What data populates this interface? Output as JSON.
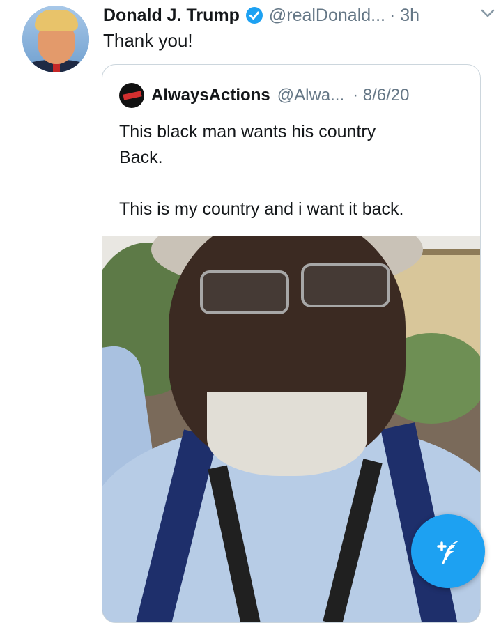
{
  "tweet": {
    "author_name": "Donald J. Trump",
    "author_handle": "@realDonald...",
    "time": "· 3h",
    "text": "Thank you!",
    "verified": true,
    "menu_icon": "chevron-down-icon"
  },
  "quoted_tweet": {
    "author_name": "AlwaysActions",
    "author_handle": "@Alwa...",
    "date": "· 8/6/20",
    "text_line1": "This black man wants his country",
    "text_line2": "Back.",
    "text_line3": "This is my country and i want it back.",
    "media": "video-thumbnail"
  },
  "compose_button": {
    "icon": "compose-feather-icon"
  },
  "colors": {
    "accent": "#1da1f2",
    "text_primary": "#14171a",
    "text_secondary": "#657786",
    "border": "#ccd6dd"
  }
}
